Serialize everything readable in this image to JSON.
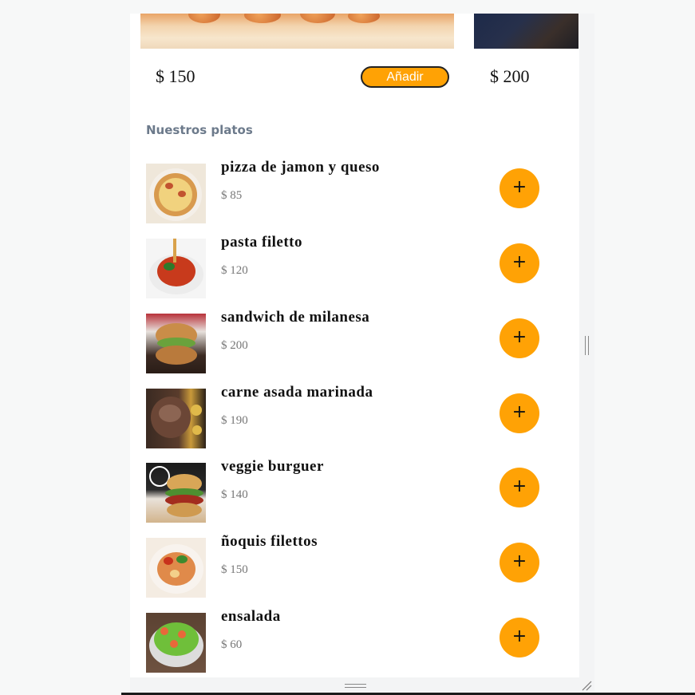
{
  "featured": {
    "items": [
      {
        "price": "$ 150",
        "add_label": "Añadir"
      },
      {
        "price": "$ 200"
      }
    ]
  },
  "section": {
    "title": "Nuestros platos"
  },
  "dishes": [
    {
      "name": "pizza de jamon y queso",
      "price": "$ 85",
      "add_label": "+"
    },
    {
      "name": "pasta filetto",
      "price": "$ 120",
      "add_label": "+"
    },
    {
      "name": "sandwich de milanesa",
      "price": "$ 200",
      "add_label": "+"
    },
    {
      "name": "carne asada marinada",
      "price": "$ 190",
      "add_label": "+"
    },
    {
      "name": "veggie burguer",
      "price": "$ 140",
      "add_label": "+"
    },
    {
      "name": "ñoquis filettos",
      "price": "$ 150",
      "add_label": "+"
    },
    {
      "name": "ensalada",
      "price": "$ 60",
      "add_label": "+"
    }
  ],
  "theme": {
    "accent": "#ffa205",
    "section_title_color": "#6c7a8b"
  },
  "icons": [
    "plus-icon",
    "resize-handle-icon",
    "resize-grip-icon"
  ]
}
